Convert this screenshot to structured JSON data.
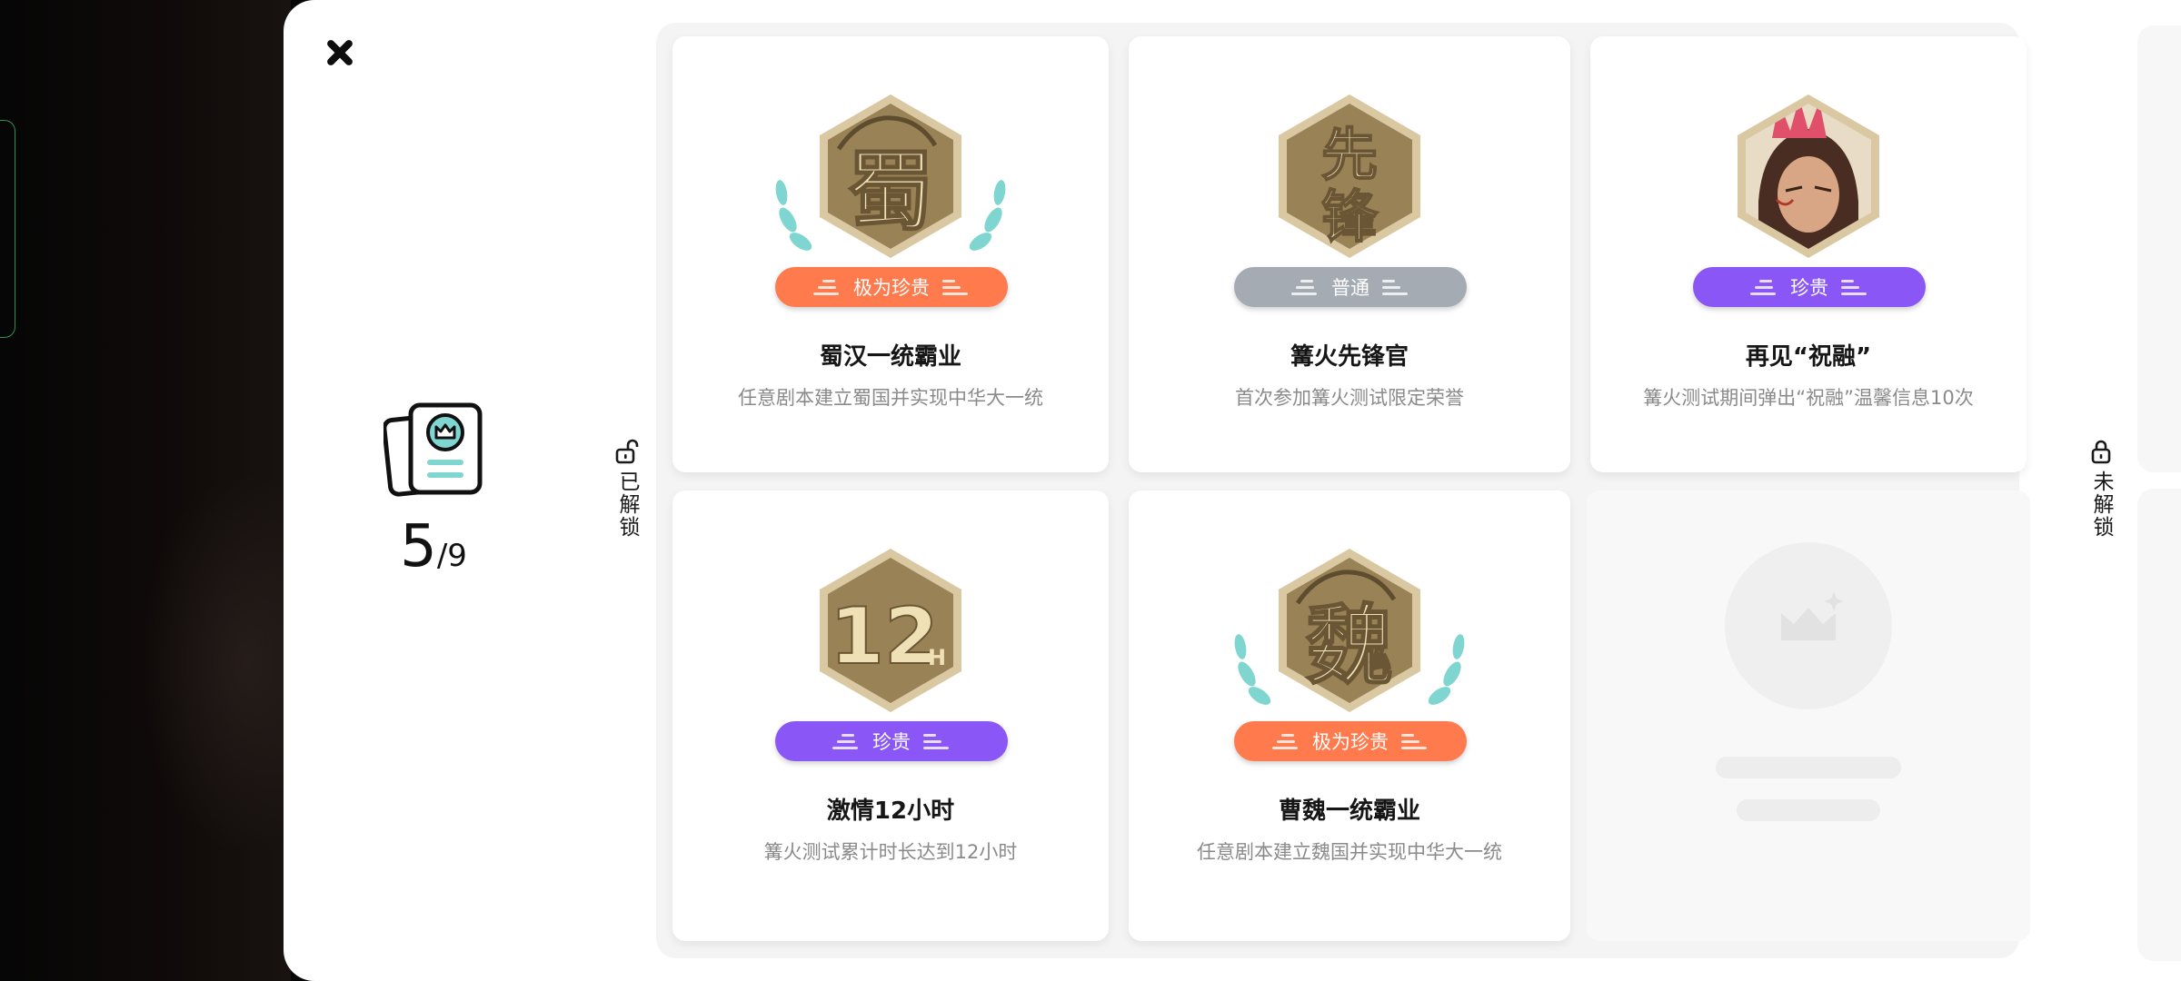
{
  "summary": {
    "unlocked_count": "5",
    "total_label": "/9"
  },
  "sections": {
    "unlocked_label": "已解锁",
    "locked_label": "未解锁"
  },
  "colors": {
    "rarity_legendary": "#ff7a4d",
    "rarity_common": "#a5abb3",
    "rarity_rare": "#8a56f5",
    "laurel": "#7fd6d0",
    "badge_gold": "#b8a070"
  },
  "achievements": [
    {
      "badge_icon": "shu-dragon-badge-icon",
      "badge_text": "蜀",
      "rarity": "极为珍贵",
      "title": "蜀汉一统霸业",
      "description": "任意剧本建立蜀国并实现中华大一统"
    },
    {
      "badge_icon": "vanguard-badge-icon",
      "badge_text": "先锋",
      "rarity": "普通",
      "title": "篝火先锋官",
      "description": "首次参加篝火测试限定荣誉"
    },
    {
      "badge_icon": "zhurong-portrait-badge-icon",
      "badge_text": "",
      "rarity": "珍贵",
      "title": "再见“祝融”",
      "description": "篝火测试期间弹出“祝融”温馨信息10次"
    },
    {
      "badge_icon": "12-hours-badge-icon",
      "badge_text": "12",
      "badge_subtext": "H",
      "rarity": "珍贵",
      "title": "激情12小时",
      "description": "篝火测试累计时长达到12小时"
    },
    {
      "badge_icon": "wei-dragon-badge-icon",
      "badge_text": "魏",
      "rarity": "极为珍贵",
      "title": "曹魏一统霸业",
      "description": "任意剧本建立魏国并实现中华大一统"
    }
  ]
}
